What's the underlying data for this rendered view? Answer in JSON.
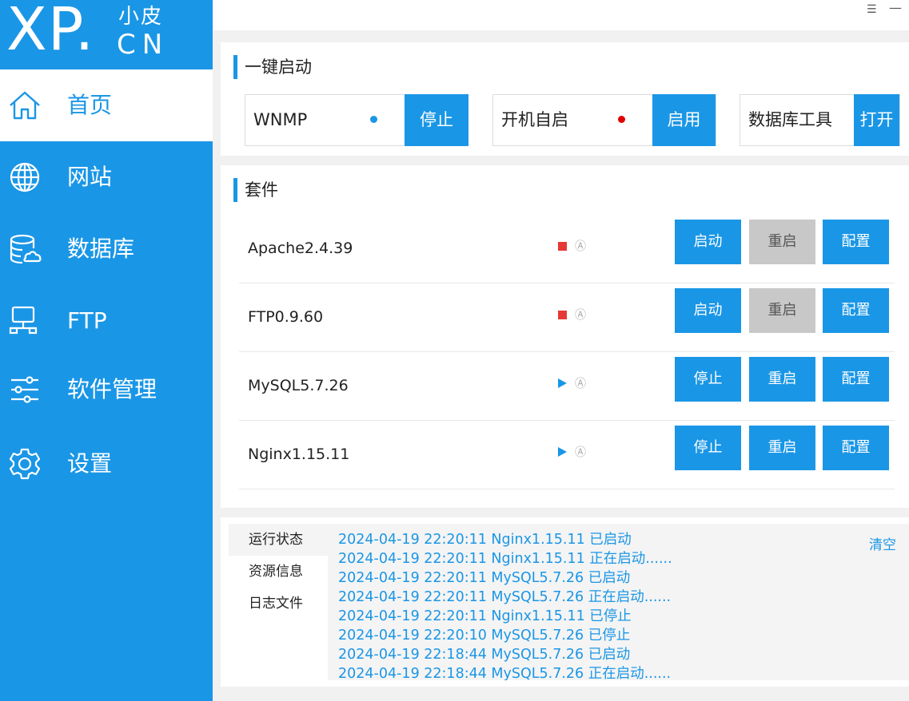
{
  "logo": {
    "big": "XP.",
    "small": "小皮",
    "cn": "CN"
  },
  "window": {
    "menu_glyph": "☰",
    "min_glyph": "—"
  },
  "sidebar": {
    "items": [
      {
        "label": "首页",
        "icon": "home-icon",
        "active": true
      },
      {
        "label": "网站",
        "icon": "globe-icon"
      },
      {
        "label": "数据库",
        "icon": "database-icon"
      },
      {
        "label": "FTP",
        "icon": "ftp-server-icon"
      },
      {
        "label": "软件管理",
        "icon": "sliders-icon"
      },
      {
        "label": "设置",
        "icon": "gear-icon"
      }
    ]
  },
  "oneclick": {
    "title": "一键启动",
    "items": [
      {
        "label": "WNMP",
        "status_color": "#1a96e6",
        "button": "停止"
      },
      {
        "label": "开机自启",
        "status_color": "#e00000",
        "button": "启用"
      },
      {
        "label": "数据库工具",
        "button": "打开"
      }
    ]
  },
  "suite": {
    "title": "套件",
    "rows": [
      {
        "name": "Apache2.4.39",
        "status": "stopped",
        "auto": "Ⓐ",
        "b1": "启动",
        "b2": "重启",
        "b3": "配置"
      },
      {
        "name": "FTP0.9.60",
        "status": "stopped",
        "auto": "Ⓐ",
        "b1": "启动",
        "b2": "重启",
        "b3": "配置"
      },
      {
        "name": "MySQL5.7.26",
        "status": "running",
        "auto": "Ⓐ",
        "b1": "停止",
        "b2": "重启",
        "b3": "配置"
      },
      {
        "name": "Nginx1.15.11",
        "status": "running",
        "auto": "Ⓐ",
        "b1": "停止",
        "b2": "重启",
        "b3": "配置"
      }
    ]
  },
  "log": {
    "tabs": [
      "运行状态",
      "资源信息",
      "日志文件"
    ],
    "clear": "清空",
    "lines": [
      "2024-04-19 22:20:11 Nginx1.15.11 已启动",
      "2024-04-19 22:20:11 Nginx1.15.11 正在启动......",
      "2024-04-19 22:20:11 MySQL5.7.26 已启动",
      "2024-04-19 22:20:11 MySQL5.7.26 正在启动......",
      "2024-04-19 22:20:11 Nginx1.15.11 已停止",
      "2024-04-19 22:20:10 MySQL5.7.26 已停止",
      "2024-04-19 22:18:44 MySQL5.7.26 已启动",
      "2024-04-19 22:18:44 MySQL5.7.26 正在启动......"
    ]
  }
}
